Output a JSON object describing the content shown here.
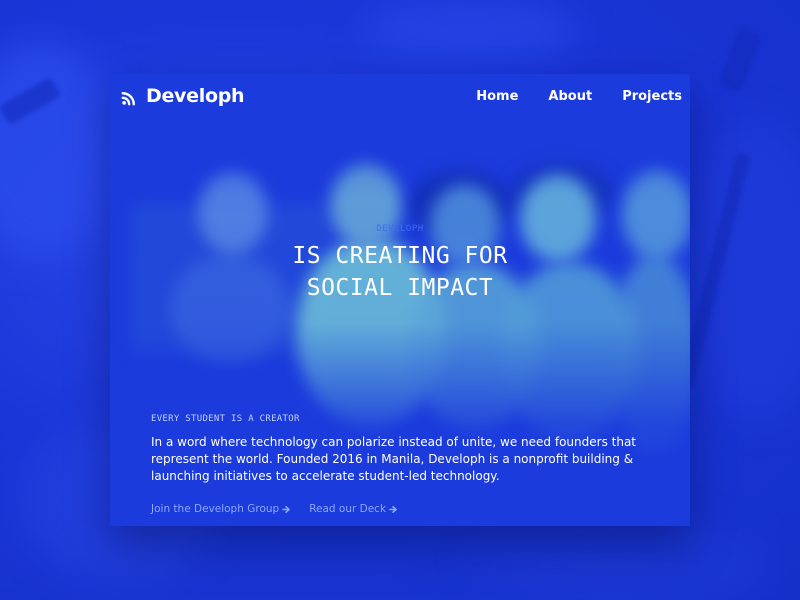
{
  "brand": {
    "name": "Developh",
    "logo_icon": "signal-waves-icon"
  },
  "nav": {
    "items": [
      {
        "label": "Home"
      },
      {
        "label": "About"
      },
      {
        "label": "Projects"
      }
    ]
  },
  "hero": {
    "eyebrow": "DEVELOPH",
    "headline_line1": "IS CREATING FOR",
    "headline_line2": "SOCIAL IMPACT"
  },
  "intro": {
    "tagline": "EVERY STUDENT IS A CREATOR",
    "description": "In a word where technology can polarize instead of unite, we need founders that represent the world. Founded 2016 in Manila, Developh is a nonprofit building & launching initiatives to accelerate student-led technology.",
    "links": [
      {
        "label": "Join the Developh Group",
        "icon": "arrow-right-icon"
      },
      {
        "label": "Read our Deck",
        "icon": "arrow-right-icon"
      }
    ]
  },
  "colors": {
    "background": "#1a34d6",
    "card": "#1b3bdc",
    "eyebrow": "#3f6cf5",
    "link": "#8ea7ff",
    "text": "#ffffff"
  }
}
